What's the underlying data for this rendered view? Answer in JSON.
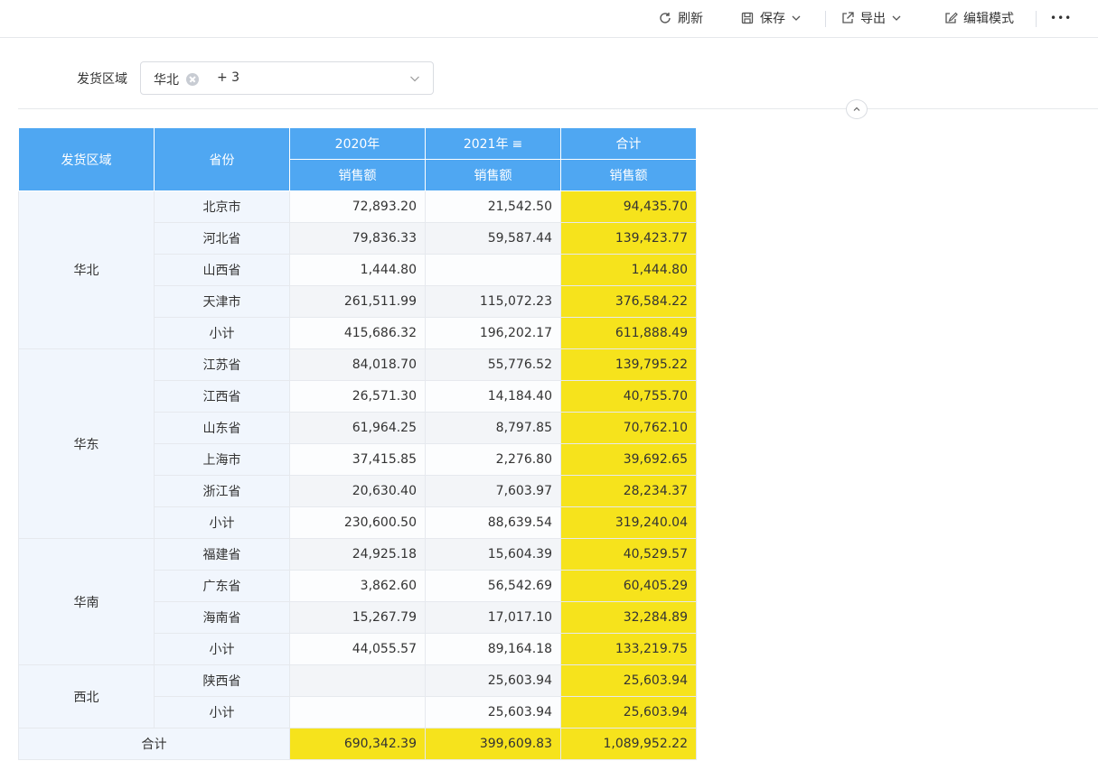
{
  "toolbar": {
    "refresh": "刷新",
    "save": "保存",
    "export": "导出",
    "edit_mode": "编辑模式",
    "more": "•••"
  },
  "filter": {
    "label": "发货区域",
    "selected_tag": "华北",
    "more_count": "+ 3"
  },
  "table": {
    "headers": {
      "region": "发货区域",
      "province": "省份",
      "y2020": "2020年",
      "y2021": "2021年",
      "y2021_icon": "≡",
      "total": "合计",
      "sales": "销售额"
    },
    "groups": [
      {
        "region": "华北",
        "rows": [
          {
            "province": "北京市",
            "v2020": "72,893.20",
            "v2021": "21,542.50",
            "total": "94,435.70"
          },
          {
            "province": "河北省",
            "v2020": "79,836.33",
            "v2021": "59,587.44",
            "total": "139,423.77"
          },
          {
            "province": "山西省",
            "v2020": "1,444.80",
            "v2021": "",
            "total": "1,444.80"
          },
          {
            "province": "天津市",
            "v2020": "261,511.99",
            "v2021": "115,072.23",
            "total": "376,584.22"
          },
          {
            "province": "小计",
            "v2020": "415,686.32",
            "v2021": "196,202.17",
            "total": "611,888.49"
          }
        ]
      },
      {
        "region": "华东",
        "rows": [
          {
            "province": "江苏省",
            "v2020": "84,018.70",
            "v2021": "55,776.52",
            "total": "139,795.22"
          },
          {
            "province": "江西省",
            "v2020": "26,571.30",
            "v2021": "14,184.40",
            "total": "40,755.70"
          },
          {
            "province": "山东省",
            "v2020": "61,964.25",
            "v2021": "8,797.85",
            "total": "70,762.10"
          },
          {
            "province": "上海市",
            "v2020": "37,415.85",
            "v2021": "2,276.80",
            "total": "39,692.65"
          },
          {
            "province": "浙江省",
            "v2020": "20,630.40",
            "v2021": "7,603.97",
            "total": "28,234.37"
          },
          {
            "province": "小计",
            "v2020": "230,600.50",
            "v2021": "88,639.54",
            "total": "319,240.04"
          }
        ]
      },
      {
        "region": "华南",
        "rows": [
          {
            "province": "福建省",
            "v2020": "24,925.18",
            "v2021": "15,604.39",
            "total": "40,529.57"
          },
          {
            "province": "广东省",
            "v2020": "3,862.60",
            "v2021": "56,542.69",
            "total": "60,405.29"
          },
          {
            "province": "海南省",
            "v2020": "15,267.79",
            "v2021": "17,017.10",
            "total": "32,284.89"
          },
          {
            "province": "小计",
            "v2020": "44,055.57",
            "v2021": "89,164.18",
            "total": "133,219.75"
          }
        ]
      },
      {
        "region": "西北",
        "rows": [
          {
            "province": "陕西省",
            "v2020": "",
            "v2021": "25,603.94",
            "total": "25,603.94"
          },
          {
            "province": "小计",
            "v2020": "",
            "v2021": "25,603.94",
            "total": "25,603.94"
          }
        ]
      }
    ],
    "grand_total": {
      "label": "合计",
      "v2020": "690,342.39",
      "v2021": "399,609.83",
      "total": "1,089,952.22"
    }
  },
  "colors": {
    "header_blue": "#4fa7f2",
    "highlight_yellow": "#f6e31c",
    "label_bg": "#f1f6fd"
  }
}
